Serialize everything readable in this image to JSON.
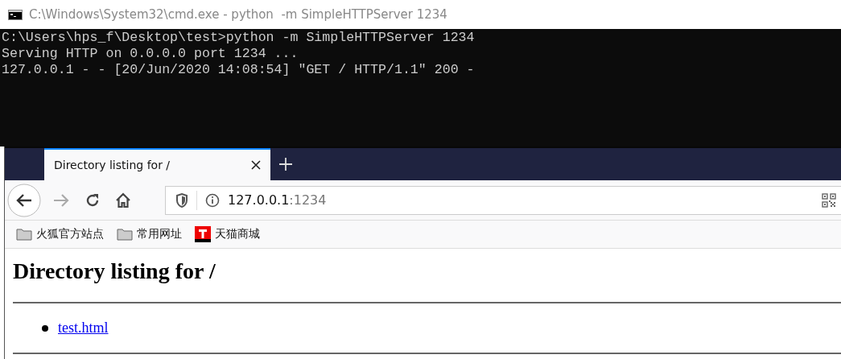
{
  "console_window": {
    "title": "C:\\Windows\\System32\\cmd.exe - python  -m SimpleHTTPServer 1234",
    "lines": [
      "C:\\Users\\hps_f\\Desktop\\test>python -m SimpleHTTPServer 1234",
      "Serving HTTP on 0.0.0.0 port 1234 ...",
      "127.0.0.1 - - [20/Jun/2020 14:08:54] ″GET / HTTP/1.1″ 200 -"
    ]
  },
  "browser": {
    "tabs": [
      {
        "label": "Directory listing for /",
        "selected": true
      }
    ],
    "address": {
      "host": "127.0.0.1",
      "port": ":1234"
    },
    "bookmarks": [
      {
        "label": "火狐官方站点",
        "kind": "folder"
      },
      {
        "label": "常用网址",
        "kind": "folder"
      },
      {
        "label": "天猫商城",
        "kind": "site"
      }
    ],
    "page": {
      "heading": "Directory listing for /",
      "links": [
        "test.html"
      ]
    }
  }
}
